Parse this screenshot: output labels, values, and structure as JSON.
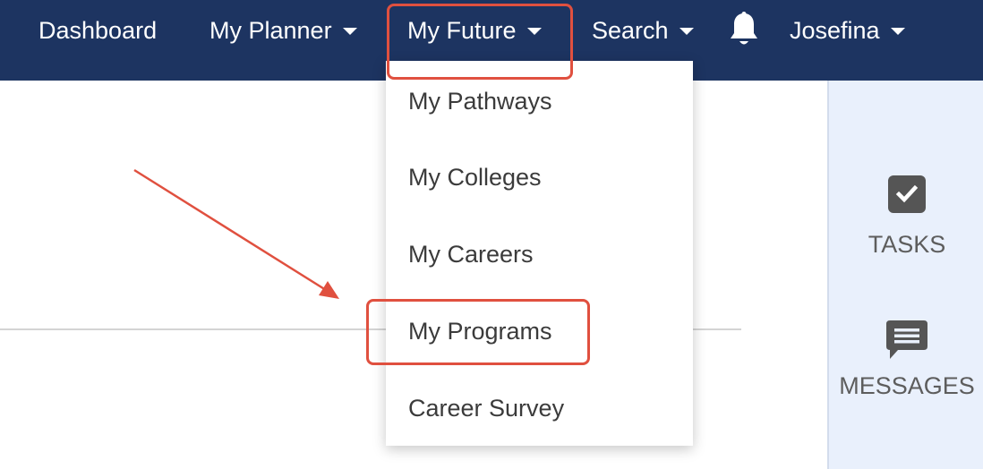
{
  "nav": {
    "dashboard": "Dashboard",
    "my_planner": "My Planner",
    "my_future": "My Future",
    "search": "Search",
    "user": "Josefina"
  },
  "dropdown": {
    "items": [
      "My Pathways",
      "My Colleges",
      "My Careers",
      "My Programs",
      "Career Survey"
    ]
  },
  "sidebar": {
    "tasks": "TASKS",
    "messages": "MESSAGES"
  },
  "colors": {
    "navbar": "#1d3461",
    "highlight": "#e0503f",
    "sidebar": "#e9f0fc"
  }
}
